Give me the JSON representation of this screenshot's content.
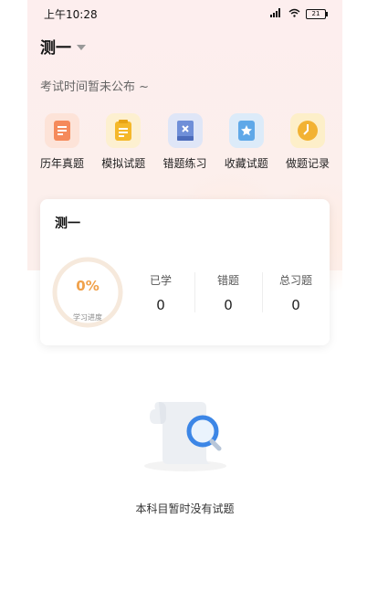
{
  "status_bar": {
    "time": "上午10:28",
    "battery": "21"
  },
  "header": {
    "subject": "测一",
    "exam_time": "考试时间暂未公布 ~"
  },
  "quick_actions": [
    {
      "label": "历年真题",
      "icon": "document-icon",
      "color": "#f58a5b"
    },
    {
      "label": "模拟试题",
      "icon": "notepad-icon",
      "color": "#f5b82a"
    },
    {
      "label": "错题练习",
      "icon": "book-x-icon",
      "color": "#6f8fd8"
    },
    {
      "label": "收藏试题",
      "icon": "star-card-icon",
      "color": "#5fa8e8"
    },
    {
      "label": "做题记录",
      "icon": "clock-icon",
      "color": "#f2b233"
    }
  ],
  "stats_card": {
    "title": "测一",
    "progress_text": "0%",
    "progress_fraction": 0,
    "progress_label": "学习进度",
    "stats": [
      {
        "label": "已学",
        "value": "0"
      },
      {
        "label": "错题",
        "value": "0"
      },
      {
        "label": "总习题",
        "value": "0"
      }
    ]
  },
  "empty_state": {
    "icon": "empty-document-search-icon",
    "text": "本科目暂时没有试题"
  }
}
